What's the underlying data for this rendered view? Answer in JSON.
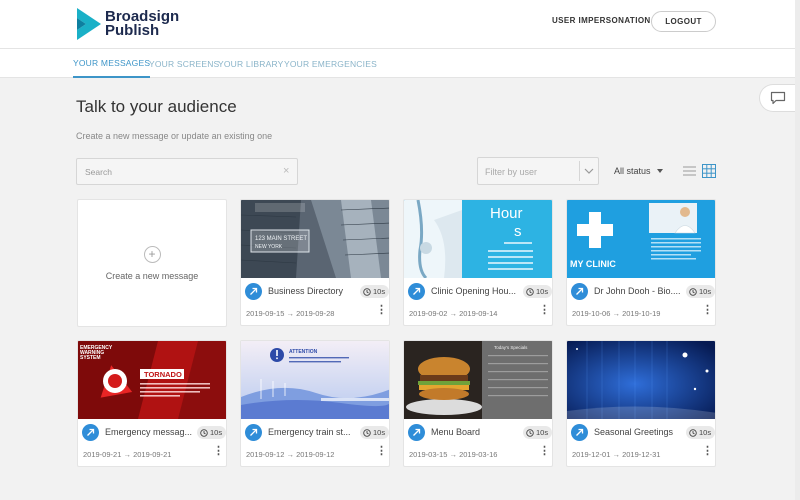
{
  "brand": {
    "line1": "Broadsign",
    "line2": "Publish"
  },
  "header": {
    "impersonation_label": "USER IMPERSONATION",
    "logout_label": "LOGOUT"
  },
  "tabs": [
    {
      "label": "YOUR MESSAGES",
      "active": true
    },
    {
      "label": "YOUR SCREENS",
      "active": false
    },
    {
      "label": "YOUR LIBRARY",
      "active": false
    },
    {
      "label": "YOUR EMERGENCIES",
      "active": false
    }
  ],
  "page": {
    "title": "Talk to your audience",
    "subtitle": "Create a new message or update an existing one"
  },
  "search": {
    "placeholder": "Search",
    "clear_glyph": "×"
  },
  "filter": {
    "placeholder": "Filter by user"
  },
  "status_select": {
    "value": "All status"
  },
  "view_toggle": {
    "list_icon": "list-view-icon",
    "grid_icon": "grid-view-icon",
    "active": "grid"
  },
  "create_card": {
    "plus": "+",
    "label": "Create a new message"
  },
  "accent_color": "#2f8dd8",
  "date_arrow": "→",
  "menu_glyph": "⋮",
  "messages": [
    {
      "title": "Business Directory",
      "duration": "10s",
      "start": "2019-09-15",
      "end": "2019-09-28",
      "thumb_text": [
        "123 MAIN STREET",
        "NEW YORK"
      ]
    },
    {
      "title": "Clinic Opening Hou...",
      "duration": "10s",
      "start": "2019-09-02",
      "end": "2019-09-14",
      "thumb_text": [
        "Hour",
        "s"
      ]
    },
    {
      "title": "Dr John Dooh - Bio....",
      "duration": "10s",
      "start": "2019-10-06",
      "end": "2019-10-19",
      "thumb_text": [
        "MY CLINIC"
      ]
    },
    {
      "title": "Emergency messag...",
      "duration": "10s",
      "start": "2019-09-21",
      "end": "2019-09-21",
      "thumb_text": [
        "EMERGENCY",
        "WARNING",
        "SYSTEM",
        "TORNADO"
      ]
    },
    {
      "title": "Emergency train st...",
      "duration": "10s",
      "start": "2019-09-12",
      "end": "2019-09-12",
      "thumb_text": [
        "ATTENTION"
      ]
    },
    {
      "title": "Menu Board",
      "duration": "10s",
      "start": "2019-03-15",
      "end": "2019-03-16",
      "thumb_text": [
        "Today's Specials"
      ]
    },
    {
      "title": "Seasonal Greetings",
      "duration": "10s",
      "start": "2019-12-01",
      "end": "2019-12-31",
      "thumb_text": []
    }
  ]
}
